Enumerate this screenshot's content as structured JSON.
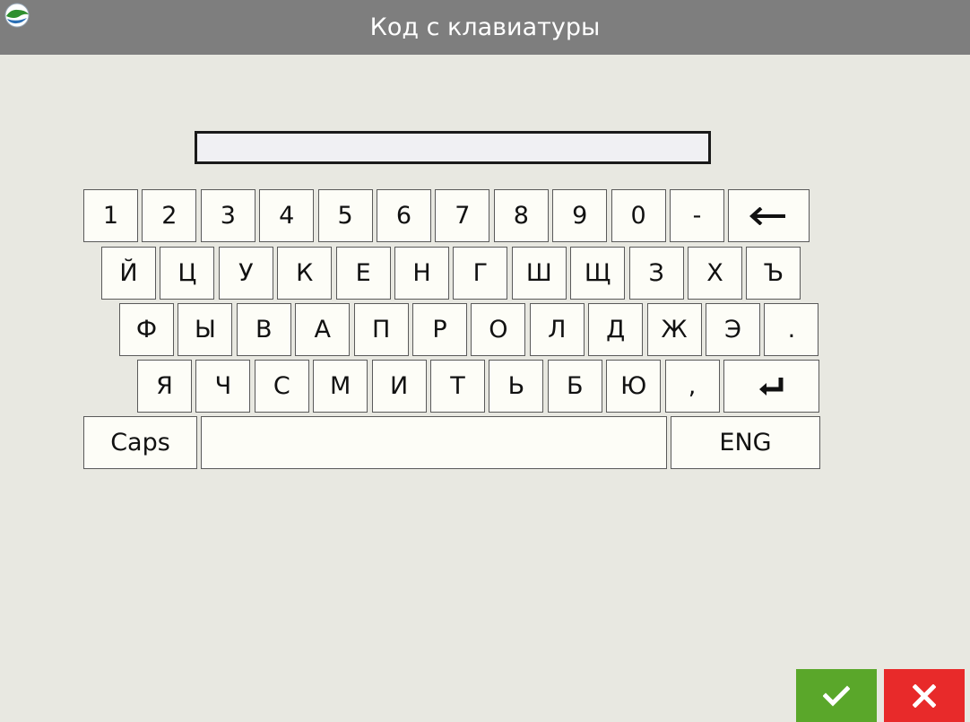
{
  "window": {
    "title": "Код с клавиатуры",
    "logo_icon": "app-logo-icon"
  },
  "input": {
    "value": "",
    "placeholder": ""
  },
  "keyboard": {
    "rows": [
      [
        {
          "label": "1",
          "name": "key-1"
        },
        {
          "label": "2",
          "name": "key-2"
        },
        {
          "label": "3",
          "name": "key-3"
        },
        {
          "label": "4",
          "name": "key-4"
        },
        {
          "label": "5",
          "name": "key-5"
        },
        {
          "label": "6",
          "name": "key-6"
        },
        {
          "label": "7",
          "name": "key-7"
        },
        {
          "label": "8",
          "name": "key-8"
        },
        {
          "label": "9",
          "name": "key-9"
        },
        {
          "label": "0",
          "name": "key-0"
        },
        {
          "label": "-",
          "name": "key-minus"
        },
        {
          "label": "",
          "name": "backspace-key",
          "icon": "backspace-arrow-icon"
        }
      ],
      [
        {
          "label": "Й",
          "name": "key-й"
        },
        {
          "label": "Ц",
          "name": "key-ц"
        },
        {
          "label": "У",
          "name": "key-у"
        },
        {
          "label": "К",
          "name": "key-к"
        },
        {
          "label": "Е",
          "name": "key-е"
        },
        {
          "label": "Н",
          "name": "key-н"
        },
        {
          "label": "Г",
          "name": "key-г"
        },
        {
          "label": "Ш",
          "name": "key-ш"
        },
        {
          "label": "Щ",
          "name": "key-щ"
        },
        {
          "label": "З",
          "name": "key-з"
        },
        {
          "label": "Х",
          "name": "key-х"
        },
        {
          "label": "Ъ",
          "name": "key-ъ"
        }
      ],
      [
        {
          "label": "Ф",
          "name": "key-ф"
        },
        {
          "label": "Ы",
          "name": "key-ы"
        },
        {
          "label": "В",
          "name": "key-в"
        },
        {
          "label": "А",
          "name": "key-а"
        },
        {
          "label": "П",
          "name": "key-п"
        },
        {
          "label": "Р",
          "name": "key-р"
        },
        {
          "label": "О",
          "name": "key-о"
        },
        {
          "label": "Л",
          "name": "key-л"
        },
        {
          "label": "Д",
          "name": "key-д"
        },
        {
          "label": "Ж",
          "name": "key-ж"
        },
        {
          "label": "Э",
          "name": "key-э"
        },
        {
          "label": ".",
          "name": "key-period"
        }
      ],
      [
        {
          "label": "Я",
          "name": "key-я"
        },
        {
          "label": "Ч",
          "name": "key-ч"
        },
        {
          "label": "С",
          "name": "key-с"
        },
        {
          "label": "М",
          "name": "key-м"
        },
        {
          "label": "И",
          "name": "key-и"
        },
        {
          "label": "Т",
          "name": "key-т"
        },
        {
          "label": "Ь",
          "name": "key-ь"
        },
        {
          "label": "Б",
          "name": "key-б"
        },
        {
          "label": "Ю",
          "name": "key-ю"
        },
        {
          "label": ",",
          "name": "key-comma"
        },
        {
          "label": "",
          "name": "enter-key",
          "icon": "enter-return-icon"
        }
      ],
      [
        {
          "label": "Caps",
          "name": "caps-key"
        },
        {
          "label": "",
          "name": "space-key"
        },
        {
          "label": "ENG",
          "name": "language-switch-key"
        }
      ]
    ]
  },
  "actions": {
    "confirm_icon": "checkmark-icon",
    "cancel_icon": "close-icon"
  },
  "colors": {
    "background": "#e8e8e1",
    "titlebar": "#7e7e7e",
    "confirm": "#5aa72a",
    "cancel": "#e82a2a"
  }
}
